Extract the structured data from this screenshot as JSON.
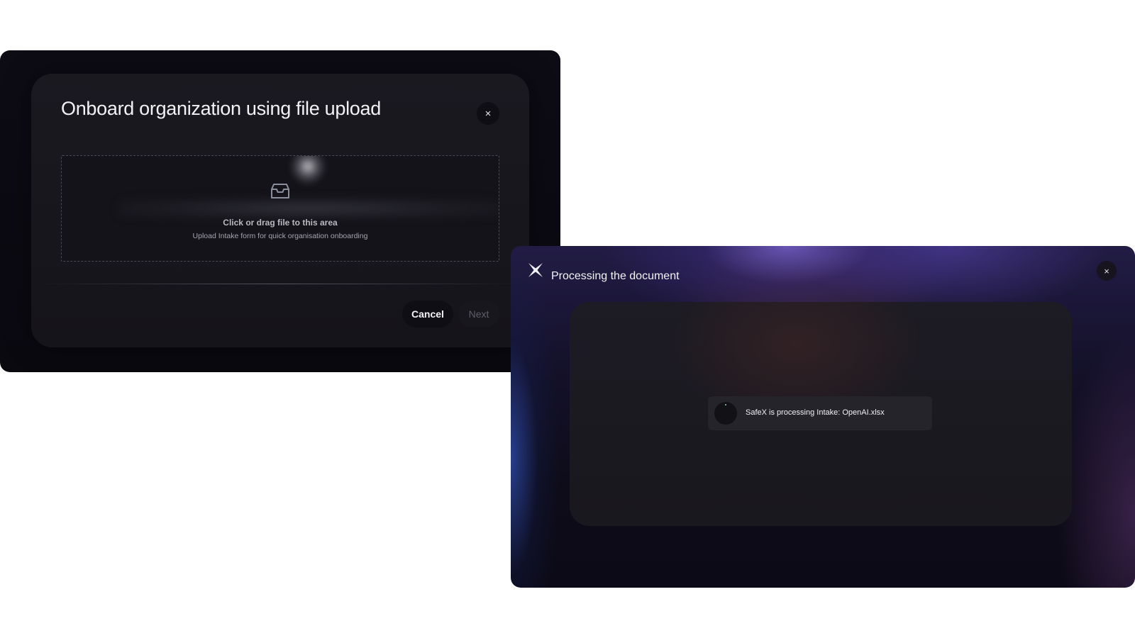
{
  "upload_modal": {
    "title": "Onboard organization using file upload",
    "close_label": "×",
    "dropzone": {
      "icon": "inbox-icon",
      "title": "Click or drag file to this area",
      "subtitle": "Upload Intake form for quick organisation onboarding"
    },
    "buttons": {
      "cancel_label": "Cancel",
      "next_label": "Next"
    }
  },
  "processing_modal": {
    "logo_icon": "sparkle-x-icon",
    "title": "Processing the document",
    "close_label": "×",
    "status": {
      "text": "SafeX is processing Intake: OpenAI.xlsx"
    }
  },
  "colors": {
    "page_background": "#ffffff",
    "modal_background": "#15141a",
    "processing_accent": "#7361c8"
  }
}
